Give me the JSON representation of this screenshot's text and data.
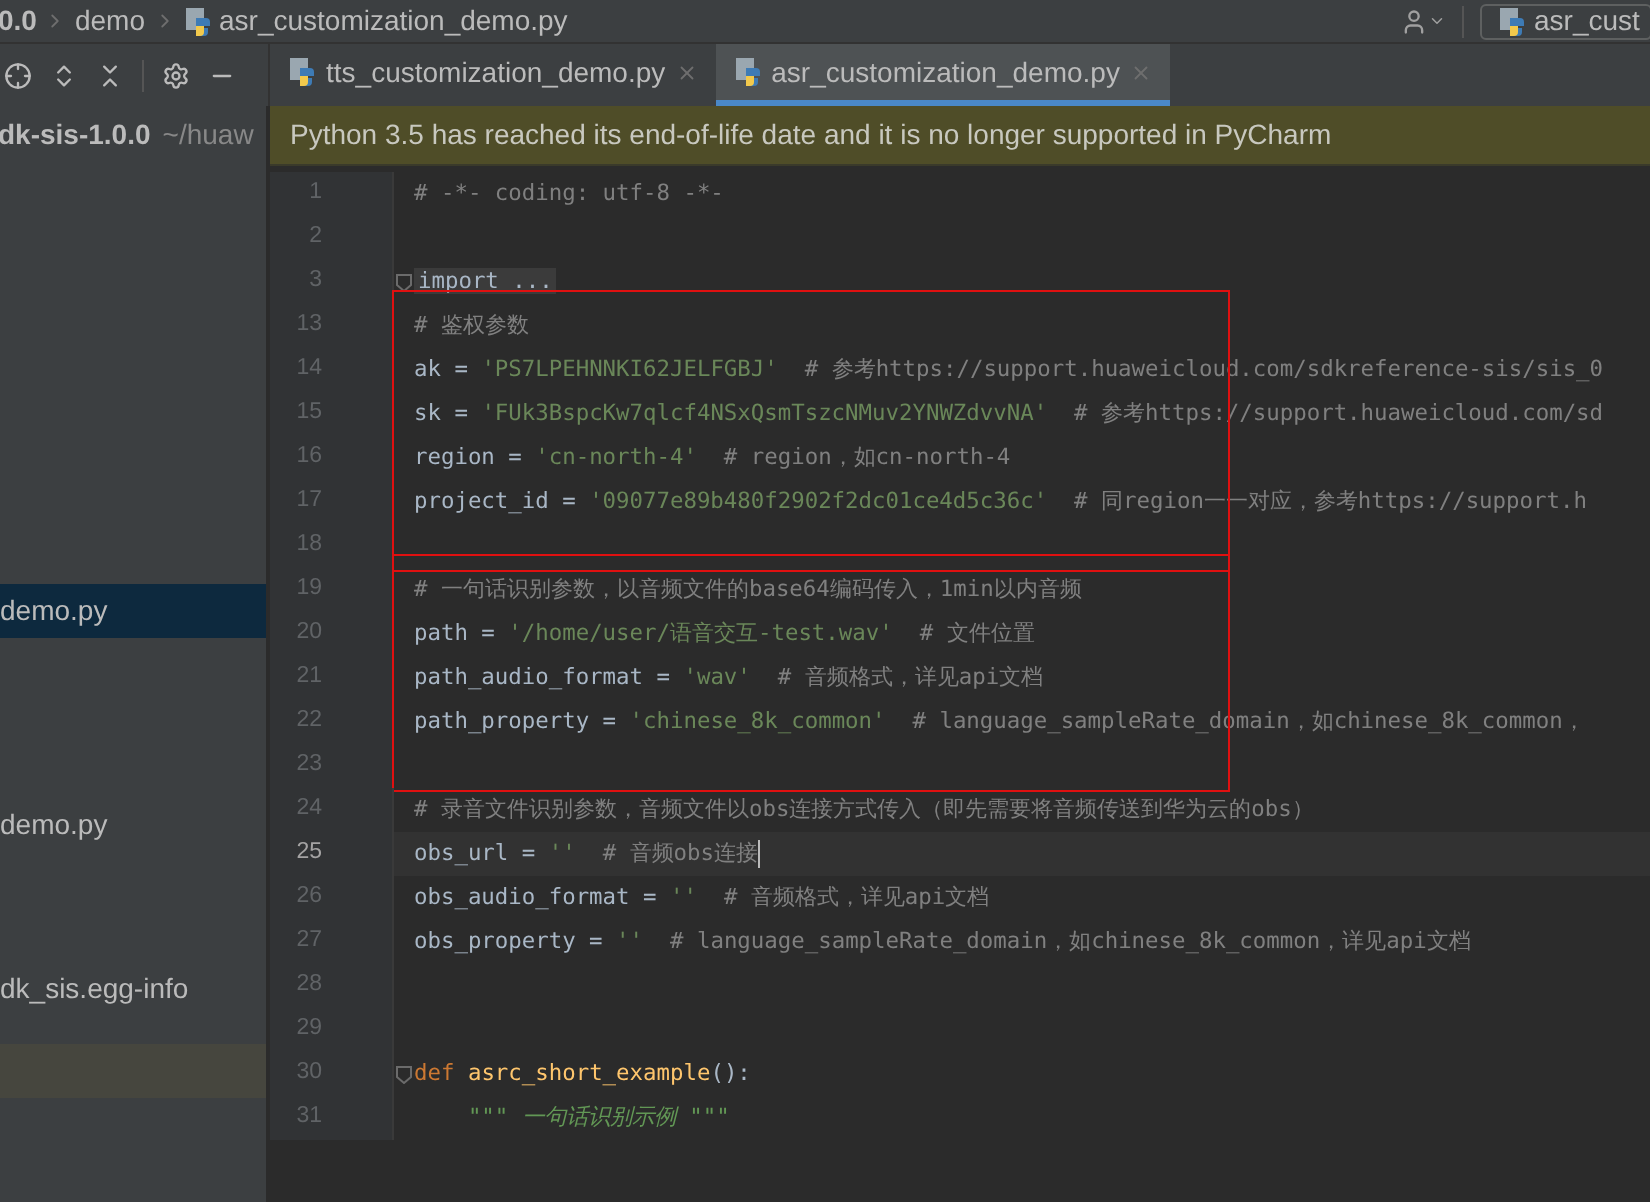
{
  "breadcrumb": {
    "items": [
      "0.0",
      "demo",
      "asr_customization_demo.py"
    ]
  },
  "run_config": {
    "label": "asr_cust"
  },
  "tool_tabs": [
    {
      "label": "tts_customization_demo.py",
      "selected": false
    },
    {
      "label": "asr_customization_demo.py",
      "selected": true
    }
  ],
  "project_tree": {
    "root": {
      "name": "dk-sis-1.0.0",
      "path": "~/huaw"
    },
    "items": [
      {
        "label": "demo.py",
        "selected": true
      },
      {
        "label": "demo.py",
        "selected": false
      },
      {
        "label": "dk_sis.egg-info",
        "selected": false
      }
    ]
  },
  "banner": {
    "text": "Python 3.5 has reached its end-of-life date and it is no longer supported in PyCharm"
  },
  "editor": {
    "sections": [
      {
        "boxed": false,
        "lines": [
          {
            "number": "1",
            "tokens": [
              {
                "kind": "comment",
                "text": "# -*- coding: utf-8 -*-"
              }
            ]
          },
          {
            "number": "2"
          },
          {
            "number": "3",
            "fold": true,
            "tokens": [
              {
                "kind": "folded",
                "text": "import ..."
              }
            ]
          }
        ]
      },
      {
        "boxed": true,
        "lines": [
          {
            "number": "13",
            "tokens": [
              {
                "kind": "comment",
                "text": "# 鉴权参数"
              }
            ]
          },
          {
            "number": "14",
            "tokens": [
              {
                "kind": "ident",
                "text": "ak = "
              },
              {
                "kind": "string",
                "text": "'PS7LPEHNNKI62JELFGBJ'"
              },
              {
                "kind": "comment",
                "text": "  # 参考https://support.huaweicloud.com/sdkreference-sis/sis_0"
              }
            ]
          },
          {
            "number": "15",
            "tokens": [
              {
                "kind": "ident",
                "text": "sk = "
              },
              {
                "kind": "string",
                "text": "'FUk3BspcKw7qlcf4NSxQsmTszcNMuv2YNWZdvvNA'"
              },
              {
                "kind": "comment",
                "text": "  # 参考https://support.huaweicloud.com/sd"
              }
            ]
          },
          {
            "number": "16",
            "tokens": [
              {
                "kind": "ident",
                "text": "region = "
              },
              {
                "kind": "string",
                "text": "'cn-north-4'"
              },
              {
                "kind": "comment",
                "text": "  # region，如cn-north-4"
              }
            ]
          },
          {
            "number": "17",
            "tokens": [
              {
                "kind": "ident",
                "text": "project_id = "
              },
              {
                "kind": "string",
                "text": "'09077e89b480f2902f2dc01ce4d5c36c'"
              },
              {
                "kind": "comment",
                "text": "  # 同region一一对应，参考https://support.h"
              }
            ]
          },
          {
            "number": "18"
          }
        ]
      },
      {
        "boxed": true,
        "lines": [
          {
            "number": "19",
            "tokens": [
              {
                "kind": "comment",
                "text": "# 一句话识别参数，以音频文件的base64编码传入，1min以内音频"
              }
            ]
          },
          {
            "number": "20",
            "tokens": [
              {
                "kind": "ident",
                "text": "path = "
              },
              {
                "kind": "string",
                "text": "'/home/user/语音交互-test.wav'"
              },
              {
                "kind": "comment",
                "text": "  # 文件位置"
              }
            ]
          },
          {
            "number": "21",
            "tokens": [
              {
                "kind": "ident",
                "text": "path_audio_format = "
              },
              {
                "kind": "string",
                "text": "'wav'"
              },
              {
                "kind": "comment",
                "text": "  # 音频格式，详见api文档"
              }
            ]
          },
          {
            "number": "22",
            "tokens": [
              {
                "kind": "ident",
                "text": "path_property = "
              },
              {
                "kind": "string",
                "text": "'chinese_8k_common'"
              },
              {
                "kind": "comment",
                "text": "  # language_sampleRate_domain，如chinese_8k_common，"
              }
            ]
          },
          {
            "number": "23"
          }
        ]
      },
      {
        "boxed": false,
        "lines": [
          {
            "number": "24",
            "tokens": [
              {
                "kind": "comment",
                "text": "# 录音文件识别参数，音频文件以obs连接方式传入（即先需要将音频传送到华为云的obs）"
              }
            ]
          },
          {
            "number": "25",
            "current": true,
            "tokens": [
              {
                "kind": "ident",
                "text": "obs_url = "
              },
              {
                "kind": "string",
                "text": "''"
              },
              {
                "kind": "comment",
                "text": "  # 音频obs连接"
              }
            ]
          },
          {
            "number": "26",
            "tokens": [
              {
                "kind": "ident",
                "text": "obs_audio_format = "
              },
              {
                "kind": "string",
                "text": "''"
              },
              {
                "kind": "comment",
                "text": "  # 音频格式，详见api文档"
              }
            ]
          },
          {
            "number": "27",
            "tokens": [
              {
                "kind": "ident",
                "text": "obs_property = "
              },
              {
                "kind": "string",
                "text": "''"
              },
              {
                "kind": "comment",
                "text": "  # language_sampleRate_domain，如chinese_8k_common，详见api文档"
              }
            ]
          },
          {
            "number": "28"
          },
          {
            "number": "29"
          },
          {
            "number": "30",
            "fold": true,
            "tokens": [
              {
                "kind": "keyword",
                "text": "def "
              },
              {
                "kind": "function",
                "text": "asrc_short_example"
              },
              {
                "kind": "ident",
                "text": "():"
              }
            ]
          },
          {
            "number": "31",
            "tokens": [
              {
                "kind": "docstring",
                "text": "    \"\"\" 一句话识别示例 \"\"\""
              }
            ]
          }
        ]
      }
    ]
  }
}
